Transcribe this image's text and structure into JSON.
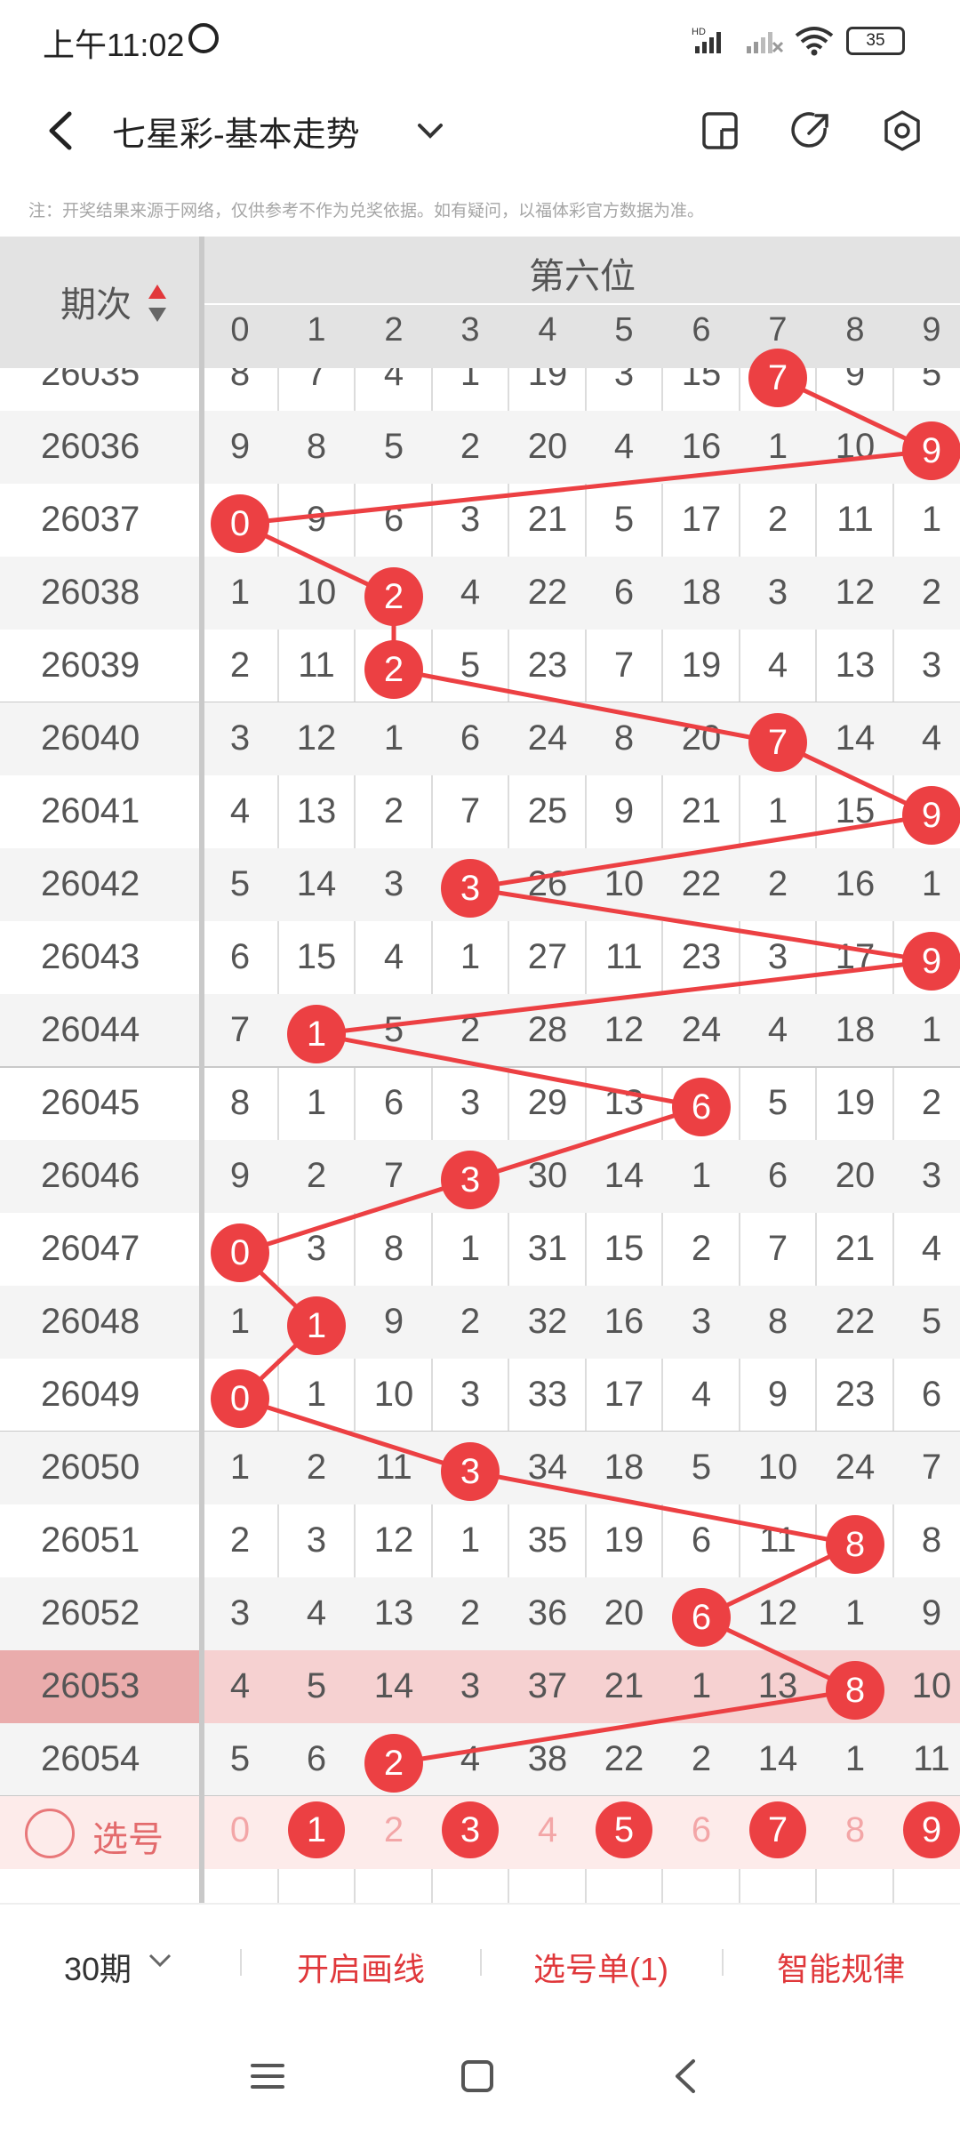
{
  "status": {
    "time": "上午11:02",
    "battery": "35",
    "net": "HD"
  },
  "header": {
    "title": "七星彩-基本走势"
  },
  "note": "注：开奖结果来源于网络，仅供参考不作为兑奖依据。如有疑问，以福体彩官方数据为准。",
  "table": {
    "issue_header": "期次",
    "position_label": "第六位",
    "digits": [
      "0",
      "1",
      "2",
      "3",
      "4",
      "5",
      "6",
      "7",
      "8",
      "9"
    ],
    "rows": [
      {
        "issue": "26035",
        "cells": [
          "8",
          "7",
          "4",
          "1",
          "19",
          "3",
          "15",
          "7",
          "9",
          "5"
        ],
        "hit": 7
      },
      {
        "issue": "26036",
        "cells": [
          "9",
          "8",
          "5",
          "2",
          "20",
          "4",
          "16",
          "1",
          "10",
          "9"
        ],
        "hit": 9
      },
      {
        "issue": "26037",
        "cells": [
          "0",
          "9",
          "6",
          "3",
          "21",
          "5",
          "17",
          "2",
          "11",
          "1"
        ],
        "hit": 0
      },
      {
        "issue": "26038",
        "cells": [
          "1",
          "10",
          "2",
          "4",
          "22",
          "6",
          "18",
          "3",
          "12",
          "2"
        ],
        "hit": 2
      },
      {
        "issue": "26039",
        "cells": [
          "2",
          "11",
          "2",
          "5",
          "23",
          "7",
          "19",
          "4",
          "13",
          "3"
        ],
        "hit": 2
      },
      {
        "issue": "26040",
        "cells": [
          "3",
          "12",
          "1",
          "6",
          "24",
          "8",
          "20",
          "7",
          "14",
          "4"
        ],
        "hit": 7
      },
      {
        "issue": "26041",
        "cells": [
          "4",
          "13",
          "2",
          "7",
          "25",
          "9",
          "21",
          "1",
          "15",
          "9"
        ],
        "hit": 9
      },
      {
        "issue": "26042",
        "cells": [
          "5",
          "14",
          "3",
          "3",
          "26",
          "10",
          "22",
          "2",
          "16",
          "1"
        ],
        "hit": 3
      },
      {
        "issue": "26043",
        "cells": [
          "6",
          "15",
          "4",
          "1",
          "27",
          "11",
          "23",
          "3",
          "17",
          "9"
        ],
        "hit": 9
      },
      {
        "issue": "26044",
        "cells": [
          "7",
          "1",
          "5",
          "2",
          "28",
          "12",
          "24",
          "4",
          "18",
          "1"
        ],
        "hit": 1
      },
      {
        "issue": "26045",
        "cells": [
          "8",
          "1",
          "6",
          "3",
          "29",
          "13",
          "6",
          "5",
          "19",
          "2"
        ],
        "hit": 6
      },
      {
        "issue": "26046",
        "cells": [
          "9",
          "2",
          "7",
          "3",
          "30",
          "14",
          "1",
          "6",
          "20",
          "3"
        ],
        "hit": 3
      },
      {
        "issue": "26047",
        "cells": [
          "0",
          "3",
          "8",
          "1",
          "31",
          "15",
          "2",
          "7",
          "21",
          "4"
        ],
        "hit": 0
      },
      {
        "issue": "26048",
        "cells": [
          "1",
          "1",
          "9",
          "2",
          "32",
          "16",
          "3",
          "8",
          "22",
          "5"
        ],
        "hit": 1
      },
      {
        "issue": "26049",
        "cells": [
          "0",
          "1",
          "10",
          "3",
          "33",
          "17",
          "4",
          "9",
          "23",
          "6"
        ],
        "hit": 0
      },
      {
        "issue": "26050",
        "cells": [
          "1",
          "2",
          "11",
          "3",
          "34",
          "18",
          "5",
          "10",
          "24",
          "7"
        ],
        "hit": 3
      },
      {
        "issue": "26051",
        "cells": [
          "2",
          "3",
          "12",
          "1",
          "35",
          "19",
          "6",
          "11",
          "8",
          "8"
        ],
        "hit": 8
      },
      {
        "issue": "26052",
        "cells": [
          "3",
          "4",
          "13",
          "2",
          "36",
          "20",
          "6",
          "12",
          "1",
          "9"
        ],
        "hit": 6
      },
      {
        "issue": "26053",
        "cells": [
          "4",
          "5",
          "14",
          "3",
          "37",
          "21",
          "1",
          "13",
          "8",
          "10"
        ],
        "hit": 8
      },
      {
        "issue": "26054",
        "cells": [
          "5",
          "6",
          "2",
          "4",
          "38",
          "22",
          "2",
          "14",
          "1",
          "11"
        ],
        "hit": 2
      }
    ],
    "highlight_issue": "26053",
    "select_row": {
      "label": "选号",
      "selected": [
        1,
        3,
        5,
        7,
        9
      ]
    }
  },
  "bottom": {
    "period": "30期",
    "draw_line": "开启画线",
    "pick_list": "选号单(1)",
    "smart": "智能规律"
  },
  "colors": {
    "accent": "#ec4043",
    "highlight_row": "#f6d1d1"
  }
}
